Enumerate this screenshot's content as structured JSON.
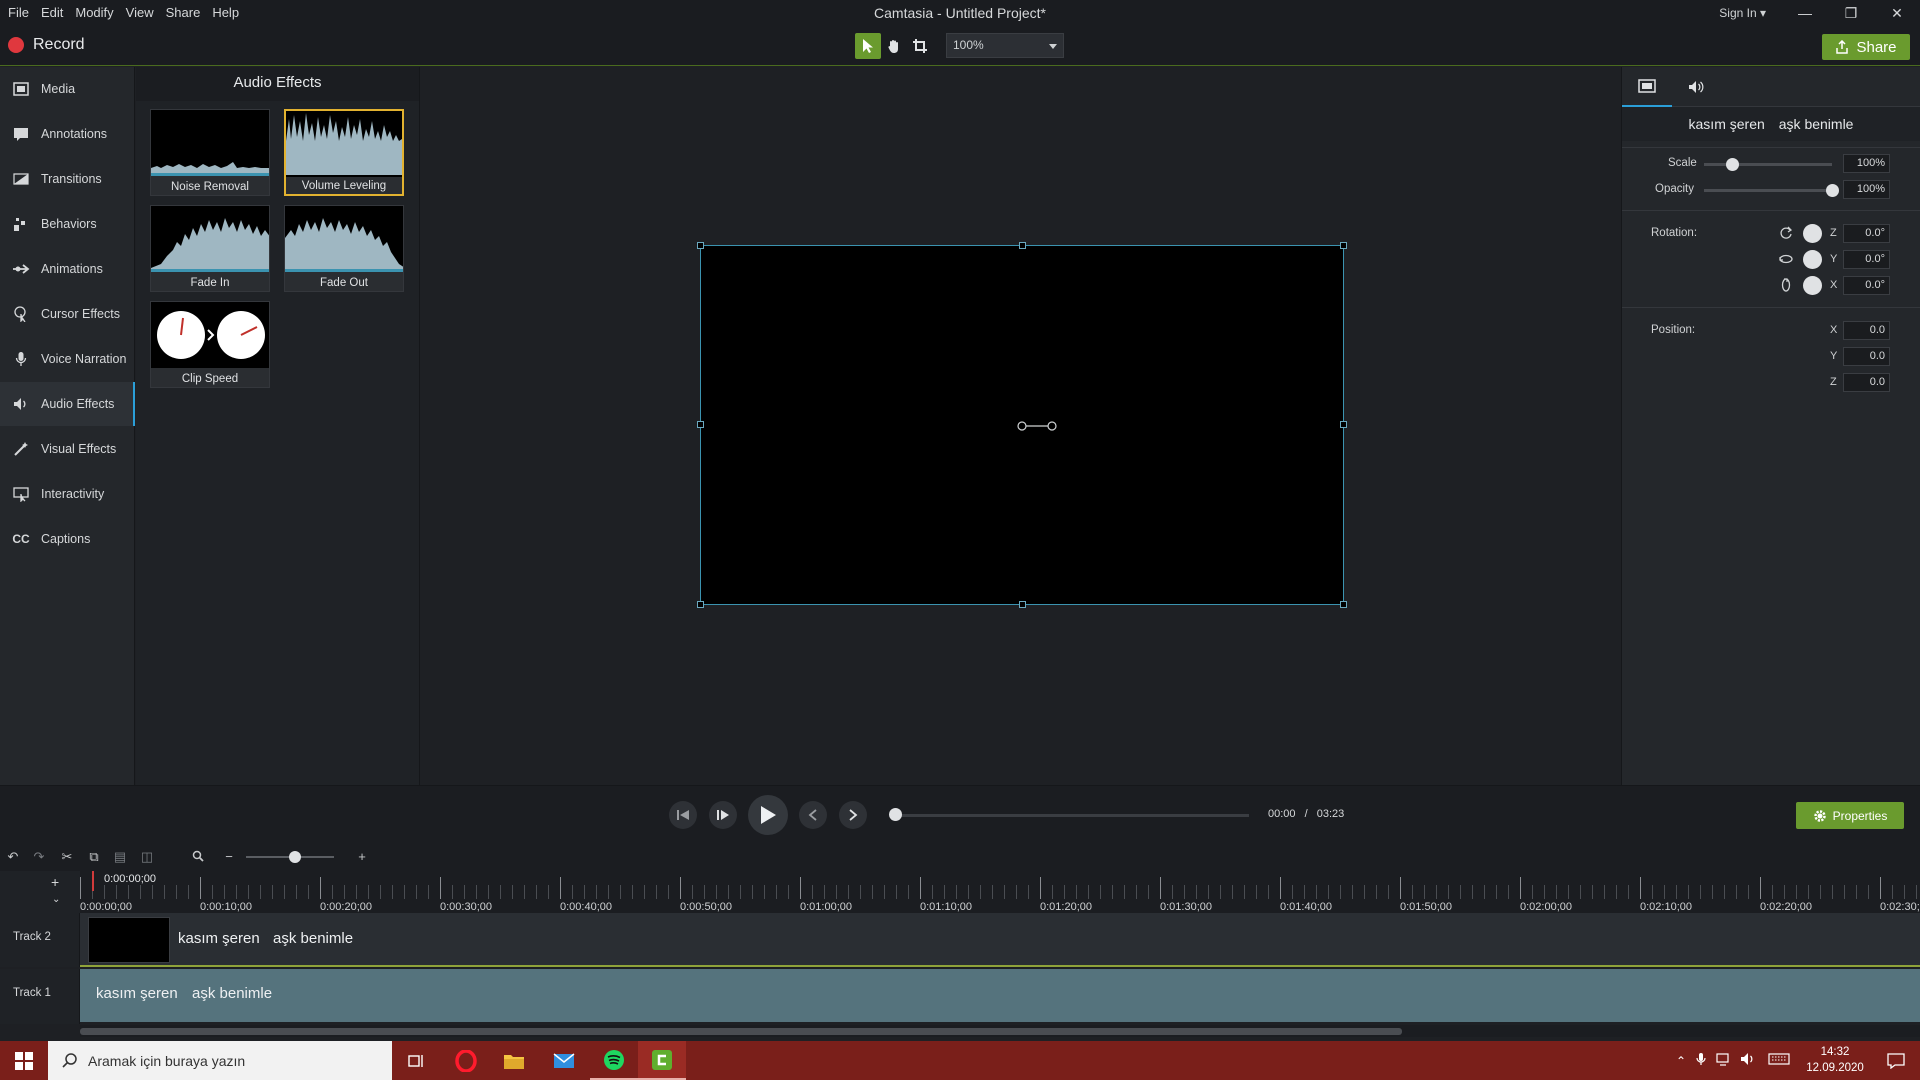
{
  "app": {
    "title": "Camtasia - Untitled Project*",
    "menu": [
      "File",
      "Edit",
      "Modify",
      "View",
      "Share",
      "Help"
    ],
    "sign_in": "Sign In ▾",
    "record_label": "Record",
    "share_label": "Share",
    "zoom_value": "100%"
  },
  "sidebar": {
    "items": [
      {
        "label": "Media",
        "icon": "film-strip-icon"
      },
      {
        "label": "Annotations",
        "icon": "annotation-icon"
      },
      {
        "label": "Transitions",
        "icon": "transition-icon"
      },
      {
        "label": "Behaviors",
        "icon": "behaviors-icon"
      },
      {
        "label": "Animations",
        "icon": "animation-arrow-icon"
      },
      {
        "label": "Cursor Effects",
        "icon": "cursor-icon"
      },
      {
        "label": "Voice Narration",
        "icon": "microphone-icon"
      },
      {
        "label": "Audio Effects",
        "icon": "speaker-icon"
      },
      {
        "label": "Visual Effects",
        "icon": "magic-wand-icon"
      },
      {
        "label": "Interactivity",
        "icon": "interactivity-icon"
      },
      {
        "label": "Captions",
        "icon": "cc-icon"
      }
    ],
    "active_index": 7
  },
  "effects_panel": {
    "title": "Audio Effects",
    "tiles": [
      {
        "label": "Noise Removal"
      },
      {
        "label": "Volume Leveling",
        "selected": true
      },
      {
        "label": "Fade In"
      },
      {
        "label": "Fade Out"
      },
      {
        "label": "Clip Speed"
      }
    ]
  },
  "properties": {
    "clip_name_1": "kasım şeren",
    "clip_name_2": "aşk benimle",
    "scale_label": "Scale",
    "scale_value": "100%",
    "scale_fraction": 0.22,
    "opacity_label": "Opacity",
    "opacity_value": "100%",
    "opacity_fraction": 1.0,
    "rotation_label": "Rotation:",
    "rotation": [
      {
        "axis": "Z",
        "value": "0.0°"
      },
      {
        "axis": "Y",
        "value": "0.0°"
      },
      {
        "axis": "X",
        "value": "0.0°"
      }
    ],
    "position_label": "Position:",
    "position": [
      {
        "axis": "X",
        "value": "0.0"
      },
      {
        "axis": "Y",
        "value": "0.0"
      },
      {
        "axis": "Z",
        "value": "0.0"
      }
    ]
  },
  "playback": {
    "current_time": "00:00",
    "separator": "/",
    "total_time": "03:23",
    "properties_label": "Properties"
  },
  "timeline": {
    "playhead_time": "0:00:00;00",
    "ruler_labels": [
      "0:00:00;00",
      "0:00:10;00",
      "0:00:20;00",
      "0:00:30;00",
      "0:00:40;00",
      "0:00:50;00",
      "0:01:00;00",
      "0:01:10;00",
      "0:01:20;00",
      "0:01:30;00",
      "0:01:40;00",
      "0:01:50;00",
      "0:02:00;00",
      "0:02:10;00",
      "0:02:20;00",
      "0:02:30;"
    ],
    "tracks": [
      {
        "name": "Track 2",
        "clip_text_1": "kasım şeren",
        "clip_text_2": "aşk benimle"
      },
      {
        "name": "Track 1",
        "clip_text_1": "kasım şeren",
        "clip_text_2": "aşk benimle"
      }
    ]
  },
  "taskbar": {
    "search_placeholder": "Aramak için buraya yazın",
    "apps": [
      "task-view-icon",
      "opera-icon",
      "file-explorer-icon",
      "mail-icon",
      "spotify-icon",
      "camtasia-icon"
    ],
    "time": "14:32",
    "date": "12.09.2020"
  },
  "colors": {
    "accent_green": "#6a9b2e",
    "selection_blue": "#2b9fd8",
    "selected_tile": "#e2b230",
    "taskbar": "#7a1f1a",
    "record_red": "#e0383e"
  }
}
